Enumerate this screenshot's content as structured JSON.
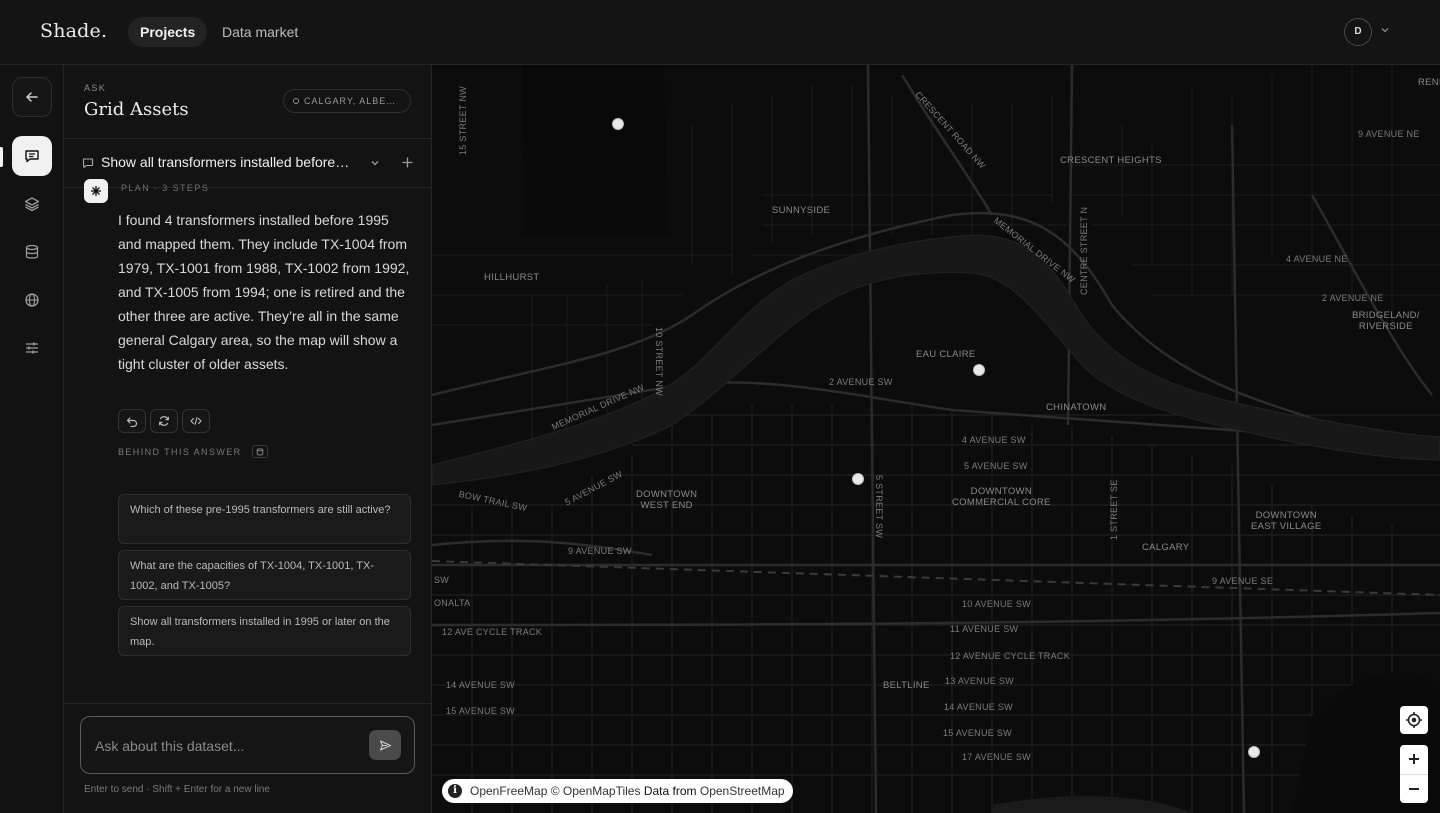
{
  "app": {
    "logo": "Shade.",
    "nav": [
      {
        "label": "Projects",
        "active": true
      },
      {
        "label": "Data market",
        "active": false
      }
    ],
    "avatar_initial": "D"
  },
  "rail": {
    "items": [
      "back-icon",
      "chat-icon",
      "layers-icon",
      "database-icon",
      "globe-icon",
      "sliders-icon"
    ],
    "active": "chat-icon"
  },
  "panel": {
    "section_label": "ASK",
    "title": "Grid Assets",
    "location_chip": "CALGARY, ALBE…",
    "thread_title": "Show all transformers installed before…",
    "plan_label": "PLAN · 3 STEPS",
    "answer": "I found 4 transformers installed before 1995 and mapped them. They include TX-1004 from 1979, TX-1001 from 1988, TX-1002 from 1992, and TX-1005 from 1994; one is retired and the other three are active. They’re all in the same general Calgary area, so the map will show a tight cluster of older assets.",
    "actions": [
      "undo-icon",
      "refresh-icon",
      "code-icon"
    ],
    "behind_label": "BEHIND THIS ANSWER",
    "suggestions": [
      "Which of these pre-1995 transformers are still active?",
      "What are the capacities of TX-1004, TX-1001, TX-1002, and TX-1005?",
      "Show all transformers installed in 1995 or later on the map."
    ],
    "composer_placeholder": "Ask about this dataset...",
    "composer_hint": "Enter to send · Shift + Enter for a new line"
  },
  "map": {
    "labels": {
      "sunnyside": "SUNNYSIDE",
      "hillhurst": "HILLHURST",
      "crescent_heights": "CRESCENT HEIGHTS",
      "eau_claire": "EAU CLAIRE",
      "chinatown": "CHINATOWN",
      "downtown_west": "DOWNTOWN\nWEST END",
      "downtown_core": "DOWNTOWN\nCOMMERCIAL CORE",
      "downtown_east": "DOWNTOWN\nEAST VILLAGE",
      "calgary": "CALGARY",
      "beltline": "BELTLINE",
      "bridgeland": "BRIDGELAND/\nRIVERSIDE",
      "renfrew": "RENFR",
      "onalta": "ONALTA",
      "ave_9_ne": "9 AVENUE NE",
      "ave_4_ne": "4 AVENUE NE",
      "ave_2_ne": "2 AVENUE NE",
      "ave_2_sw": "2 AVENUE SW",
      "ave_4_sw": "4 AVENUE SW",
      "ave_5_sw": "5 AVENUE SW",
      "ave_5_sw_b": "5 AVENUE SW",
      "ave_9_sw": "9 AVENUE SW",
      "ave_9_se": "9 AVENUE SE",
      "ave_10_sw": "10 AVENUE SW",
      "ave_11_sw": "11 AVENUE SW",
      "cycle_track_a": "12 AVE CYCLE TRACK",
      "cycle_track_b": "12 AVENUE CYCLE TRACK",
      "ave_13_sw": "13 AVENUE SW",
      "ave_14_sw": "14 AVENUE SW",
      "ave_14_sw_b": "14 AVENUE SW",
      "ave_15_sw": "15 AVENUE SW",
      "ave_15_sw_b": "15 AVENUE SW",
      "ave_17_sw": "17 AVENUE SW",
      "bow_trail": "BOW TRAIL SW",
      "memorial_nw": "MEMORIAL DRIVE NW",
      "memorial_ne": "MEMORIAL DRIVE NW",
      "crescent_road": "CRESCENT ROAD NW",
      "st_15_nw": "15 STREET NW",
      "st_10_nw": "10 STREET NW",
      "centre_st_n": "CENTRE STREET N",
      "st_5_sw": "5 STREET SW",
      "st_1_se": "1 STREET SE",
      "edge_sw": "SW"
    },
    "marker_count": 4,
    "attribution": {
      "openfreemap": "OpenFreeMap",
      "copy": "© OpenMapTiles",
      "data_from": "Data from",
      "osm": "OpenStreetMap"
    },
    "controls": [
      "locate-icon",
      "zoom-in-icon",
      "zoom-out-icon"
    ]
  }
}
